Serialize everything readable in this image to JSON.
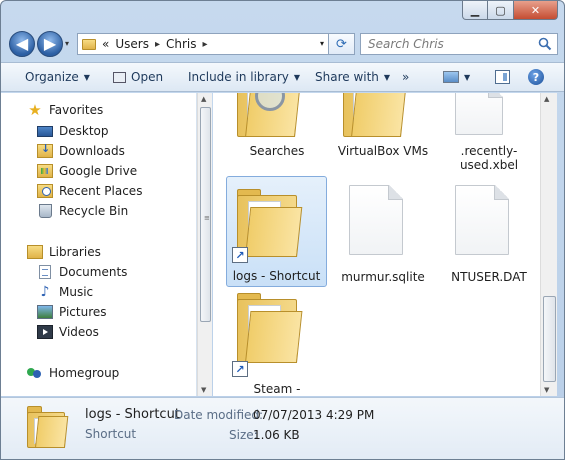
{
  "window": {
    "controls": {
      "minimize": "▁",
      "maximize": "▢",
      "close": "✕"
    }
  },
  "nav": {
    "back_glyph": "◀",
    "forward_glyph": "▶",
    "recent_glyph": "▾",
    "breadcrumb": {
      "overflow": "«",
      "segments": [
        "Users",
        "Chris"
      ],
      "separator": "▸",
      "dropdown_glyph": "▾"
    },
    "refresh_glyph": "⟳",
    "search": {
      "placeholder": "Search Chris"
    }
  },
  "toolbar": {
    "organize": "Organize",
    "open": "Open",
    "include_in_library": "Include in library",
    "share_with": "Share with",
    "more": "»",
    "help": "?"
  },
  "sidebar": {
    "favorites": {
      "label": "Favorites",
      "items": [
        "Desktop",
        "Downloads",
        "Google Drive",
        "Recent Places",
        "Recycle Bin"
      ]
    },
    "libraries": {
      "label": "Libraries",
      "items": [
        "Documents",
        "Music",
        "Pictures",
        "Videos"
      ]
    },
    "homegroup": {
      "label": "Homegroup"
    }
  },
  "files": [
    {
      "name": "Searches",
      "kind": "folder"
    },
    {
      "name": "VirtualBox VMs",
      "kind": "folder"
    },
    {
      "name": ".recently-used.xbel",
      "kind": "document"
    },
    {
      "name": "logs - Shortcut",
      "kind": "folder-shortcut",
      "selected": true
    },
    {
      "name": "murmur.sqlite",
      "kind": "document"
    },
    {
      "name": "NTUSER.DAT",
      "kind": "document"
    },
    {
      "name": "Steam - Shortcut",
      "kind": "folder-shortcut"
    }
  ],
  "details": {
    "name": "logs - Shortcut",
    "type": "Shortcut",
    "date_modified_label": "Date modified:",
    "date_modified": "07/07/2013 4:29 PM",
    "size_label": "Size:",
    "size": "1.06 KB"
  },
  "colors": {
    "selection": "#c9e0f7",
    "accent": "#1e395b"
  }
}
